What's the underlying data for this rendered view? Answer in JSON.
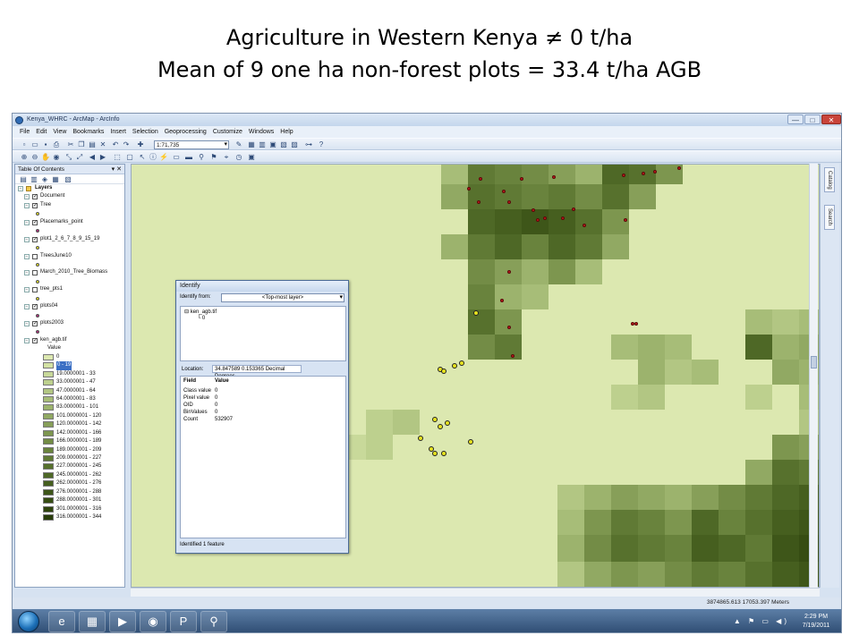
{
  "slide": {
    "title_line1": "Agriculture in Western Kenya ≠ 0 t/ha",
    "title_line2": "Mean of 9 one ha non-forest plots = 33.4 t/ha AGB"
  },
  "window": {
    "title": "Kenya_WHRC - ArcMap - ArcInfo",
    "controls": {
      "minimize": "—",
      "maximize": "□",
      "close": "✕"
    }
  },
  "menu": [
    "File",
    "Edit",
    "View",
    "Bookmarks",
    "Insert",
    "Selection",
    "Geoprocessing",
    "Customize",
    "Windows",
    "Help"
  ],
  "toolbar": {
    "scale": "1:71,735"
  },
  "toc": {
    "header": "Table Of Contents",
    "header_controls": "▾ ✕",
    "layers_root": "Layers",
    "layers": [
      {
        "name": "Document",
        "checked": true,
        "symbol_color": null
      },
      {
        "name": "Tree",
        "checked": true,
        "symbol_color": "#e7e31f"
      },
      {
        "name": "Placemarks_point",
        "checked": true,
        "symbol_color": "#b0287a"
      },
      {
        "name": "plot1_2_6_7_8_9_15_19",
        "checked": true,
        "symbol_color": "#e7e31f"
      },
      {
        "name": "TreesJune10",
        "checked": false,
        "symbol_color": "#e7e31f"
      },
      {
        "name": "March_2010_Tree_Biomass",
        "checked": false,
        "symbol_color": "#e7e31f"
      },
      {
        "name": "tree_pts1",
        "checked": false,
        "symbol_color": "#e7e31f"
      },
      {
        "name": "plots04",
        "checked": true,
        "symbol_color": "#b0287a"
      },
      {
        "name": "plots2003",
        "checked": true,
        "symbol_color": "#b0287a"
      },
      {
        "name": "ken_agb.tif",
        "checked": true,
        "symbol_color": null
      }
    ],
    "value_header": "Value",
    "classes": [
      {
        "label": "0",
        "color": "#dce8b0"
      },
      {
        "label": "0 - 19",
        "color": "#d3e2a4",
        "selected": true
      },
      {
        "label": "19.0000001 - 33",
        "color": "#c8d99a"
      },
      {
        "label": "33.0000001 - 47",
        "color": "#bdd08e"
      },
      {
        "label": "47.0000001 - 64",
        "color": "#b2c683"
      },
      {
        "label": "64.0000001 - 83",
        "color": "#a7bd78"
      },
      {
        "label": "83.0000001 - 101",
        "color": "#9cb36d"
      },
      {
        "label": "101.0000001 - 120",
        "color": "#91a963"
      },
      {
        "label": "120.0000001 - 142",
        "color": "#879f59"
      },
      {
        "label": "142.0000001 - 166",
        "color": "#7d964f"
      },
      {
        "label": "166.0000001 - 189",
        "color": "#738c46"
      },
      {
        "label": "189.0000001 - 209",
        "color": "#69833d"
      },
      {
        "label": "209.0000001 - 227",
        "color": "#607a35"
      },
      {
        "label": "227.0000001 - 245",
        "color": "#57712d"
      },
      {
        "label": "245.0000001 - 262",
        "color": "#4e6826"
      },
      {
        "label": "262.0000001 - 276",
        "color": "#465f1f"
      },
      {
        "label": "276.0000001 - 288",
        "color": "#3e5619"
      },
      {
        "label": "288.0000001 - 301",
        "color": "#364d13"
      },
      {
        "label": "301.0000001 - 316",
        "color": "#2f450e"
      },
      {
        "label": "316.0000001 - 344",
        "color": "#283d0a"
      }
    ]
  },
  "identify": {
    "title": "Identify",
    "from_label": "Identify from:",
    "from_value": "<Top-most layer>",
    "tree_layer": "ken_agb.tif",
    "tree_value": "0",
    "location_label": "Location:",
    "location_value": "34.847589  0.153365 Decimal Degrees",
    "columns": [
      "Field",
      "Value"
    ],
    "rows": [
      {
        "field": "Class value",
        "value": "0"
      },
      {
        "field": "Pixel value",
        "value": "0"
      },
      {
        "field": "OID",
        "value": "0"
      },
      {
        "field": "BinValues",
        "value": "0"
      },
      {
        "field": "Count",
        "value": "532907"
      }
    ],
    "status": "Identified 1 feature"
  },
  "statusbar": {
    "coords": "3874865.613  17053.397 Meters"
  },
  "taskbar": {
    "clock_time": "2:29 PM",
    "clock_date": "7/19/2011",
    "tray_icons": "▲ ⚑ ▭ ◀)"
  },
  "dock": {
    "catalog": "Catalog",
    "search": "Search"
  },
  "colors": {
    "map_background": "#dce8b0",
    "red_point": "#c01818",
    "yellow_point": "#e6e21e"
  }
}
